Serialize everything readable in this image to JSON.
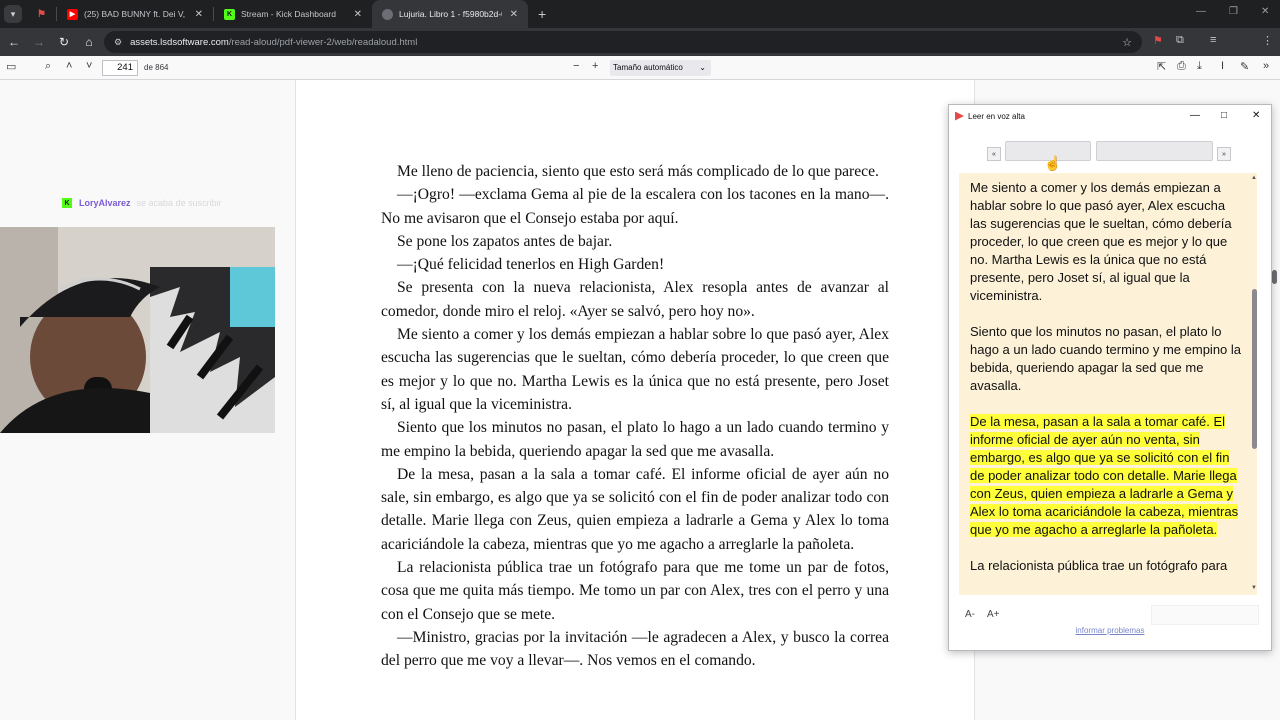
{
  "browser": {
    "tabs": [
      {
        "title": "",
        "favicon": "flag-icon"
      },
      {
        "title": "(25) BAD BUNNY ft. Dei V, Omar",
        "favicon": "youtube-icon"
      },
      {
        "title": "Stream - Kick Dashboard",
        "favicon": "kick-icon"
      },
      {
        "title": "Lujuria. Libro 1 - f5980b2d-06d",
        "favicon": "globe-icon",
        "active": true
      }
    ],
    "new_tab": "+",
    "address": {
      "host": "assets.lsdsoftware.com",
      "path": "/read-aloud/pdf-viewer-2/web/readaloud.html"
    }
  },
  "pdf_toolbar": {
    "page_number": "241",
    "page_count": "de 864",
    "zoom_label": "Tamaño automático"
  },
  "stream_overlay": {
    "streamer_name": "LoryAlvarez",
    "message": "se acaba de suscribir"
  },
  "page": {
    "paragraphs": [
      "Me lleno de paciencia, siento que esto será más complicado de lo que parece.",
      "—¡Ogro! —exclama Gema al pie de la escalera con los tacones en la mano—. No me avisaron que el Consejo estaba por aquí.",
      "Se pone los zapatos antes de bajar.",
      "—¡Qué felicidad tenerlos en High Garden!",
      "Se presenta con la nueva relacionista, Alex resopla antes de avanzar al comedor, donde miro el reloj. «Ayer se salvó, pero hoy no».",
      "Me siento a comer y los demás empiezan a hablar sobre lo que pasó ayer, Alex escucha las sugerencias que le sueltan, cómo debería proceder, lo que creen que es mejor y lo que no. Martha Lewis es la única que no está presente, pero Joset sí, al igual que la viceministra.",
      "Siento que los minutos no pasan, el plato lo hago a un lado cuando termino y me empino la bebida, queriendo apagar la sed que me avasalla.",
      "De la mesa, pasan a la sala a tomar café. El informe oficial de ayer aún no sale, sin embargo, es algo que ya se solicitó con el fin de poder analizar todo con detalle. Marie llega con Zeus, quien empieza a ladrarle a Gema y Alex lo toma acariciándole la cabeza, mientras que yo me agacho a arreglarle la pañoleta.",
      "La relacionista pública trae un fotógrafo para que me tome un par de fotos, cosa que me quita más tiempo. Me tomo un par con Alex, tres con el perro y una con el Consejo que se mete.",
      "—Ministro, gracias por la invitación —le agradecen a Alex, y busco la correa del perro que me voy a llevar—. Nos vemos en el comando."
    ]
  },
  "read_aloud": {
    "title": "Leer en voz alta",
    "prev_label": "«",
    "next_label": "»",
    "paragraphs": [
      "Me siento a comer y los demás empiezan a hablar sobre lo que pasó ayer, Alex escucha las sugerencias que le sueltan, cómo debería proceder, lo que creen que es mejor y lo que no. Martha Lewis es la única que no está presente, pero Joset sí, al igual que la viceministra.",
      "Siento que los minutos no pasan, el plato lo hago a un lado cuando termino y me empino la bebida, queriendo apagar la sed que me avasalla.",
      "De la mesa, pasan a la sala a tomar café. El informe oficial de ayer aún no venta, sin embargo, es algo que ya se solicitó con el fin de poder analizar todo con detalle. Marie llega con Zeus, quien empieza a ladrarle a Gema y Alex lo toma acariciándole la cabeza, mientras que yo me agacho a arreglarle la pañoleta.",
      "La relacionista pública trae un fotógrafo para"
    ],
    "font_decrease": "A-",
    "font_increase": "A+",
    "report_link": "informar problemas"
  },
  "colors": {
    "highlight": "#ffff3a",
    "reader_bg": "#fdf1d8",
    "kick_green": "#53fc18"
  }
}
